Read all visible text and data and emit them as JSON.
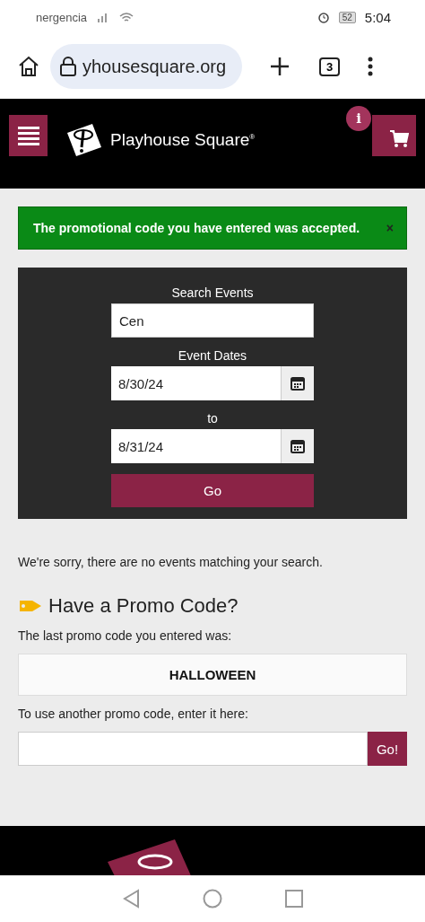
{
  "status_bar": {
    "carrier": "nergencia",
    "battery": "52",
    "time": "5:04"
  },
  "browser": {
    "url": "yhousesquare.org",
    "tab_count": "3"
  },
  "header": {
    "brand": "Playhouse Square$^{®}$",
    "cart_badge": "i"
  },
  "alert": {
    "message": "The promotional code you have entered was accepted.",
    "close": "×"
  },
  "search": {
    "label": "Search Events",
    "value": "Cen",
    "dates_label": "Event Dates",
    "from": "8/30/24",
    "to_label": "to",
    "to": "8/31/24",
    "button": "Go"
  },
  "no_results": "We're sorry, there are no events matching your search.",
  "promo": {
    "title": "Have a Promo Code?",
    "last_label": "The last promo code you entered was:",
    "last_code": "HALLOWEEN",
    "another_label": "To use another promo code, enter it here:",
    "button": "Go!"
  }
}
